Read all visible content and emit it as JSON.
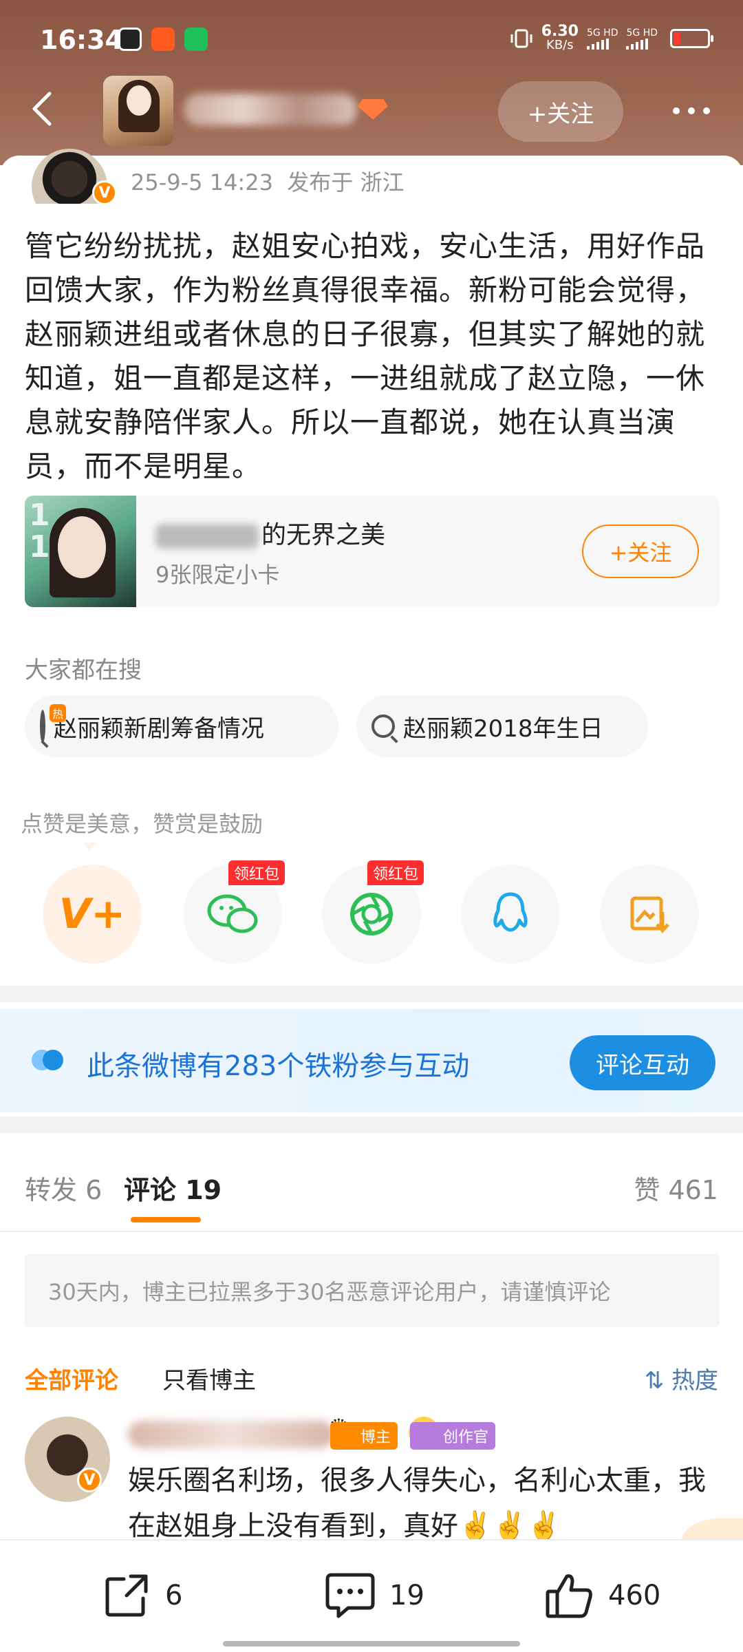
{
  "status_bar": {
    "time": "16:34",
    "net_speed_value": "6.30",
    "net_speed_unit": "KB/s",
    "sim1": "5G HD",
    "sim2": "5G HD"
  },
  "nav": {
    "follow_label": "+关注"
  },
  "post": {
    "meta": "25-9-5 14:23  发布于 浙江",
    "text": "管它纷纷扰扰，赵姐安心拍戏，安心生活，用好作品回馈大家，作为粉丝真得很幸福。新粉可能会觉得，赵丽颖进组或者休息的日子很寡，但其实了解她的就知道，姐一直都是这样，一进组就成了赵立隐，一休息就安静陪伴家人。所以一直都说，她在认真当演员，而不是明星。",
    "collection": {
      "title": "的无界之美",
      "subtitle": "9张限定小卡",
      "follow_label": "+关注"
    }
  },
  "search": {
    "heading": "大家都在搜",
    "hot_flag": "热",
    "chips": [
      "赵丽颖新剧筹备情况",
      "赵丽颖2018年生日"
    ]
  },
  "reward": {
    "hint": "点赞是美意，赞赏是鼓励",
    "red_packet_label": "领红包"
  },
  "fan_banner": {
    "text": "此条微博有283个铁粉参与互动",
    "button": "评论互动"
  },
  "tabs": {
    "repost": "转发 6",
    "comment": "评论 19",
    "like": "赞 461"
  },
  "notice": "30天内，博主已拉黑多于30名恶意评论用户，请谨慎评论",
  "filters": {
    "all": "全部评论",
    "author_only": "只看博主",
    "sort": "热度"
  },
  "comment": {
    "badge_blogger": "博主",
    "badge_creator": "创作官",
    "text": "娱乐圈名利场，很多人得失心，名利心太重，我在赵姐身上没有看到，真好✌️✌️✌️"
  },
  "bottom_bar": {
    "repost_count": "6",
    "comment_count": "19",
    "like_count": "460"
  },
  "colors": {
    "accent_orange": "#ff8200",
    "header_brown": "#8a5642",
    "link_blue": "#1b73d6"
  }
}
